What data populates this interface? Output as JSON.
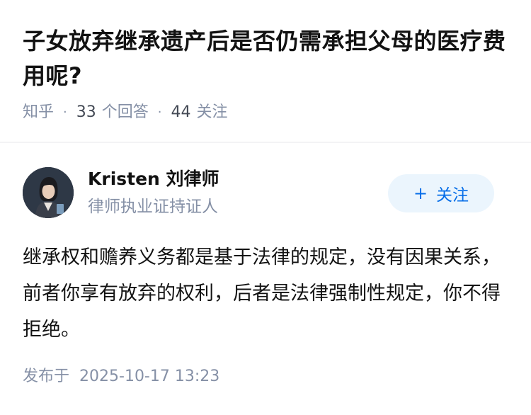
{
  "question": {
    "title": "子女放弃继承遗产后是否仍需承担父母的医疗费用呢?",
    "source": "知乎",
    "separator": "·",
    "answer_count": "33",
    "answer_label": "个回答",
    "follower_count": "44",
    "follower_label": "关注"
  },
  "author": {
    "name": "Kristen 刘律师",
    "bio": "律师执业证持证人",
    "avatar_icon": "person-portrait-icon"
  },
  "follow_button": {
    "plus": "+",
    "label": "关注"
  },
  "answer": {
    "content": "继承权和赡养义务都是基于法律的规定，没有因果关系，前者你享有放弃的权利，后者是法律强制性规定，你不得拒绝。",
    "published_label": "发布于",
    "published_time": "2025-10-17 13:23"
  },
  "colors": {
    "accent": "#056de8",
    "accent_bg": "#ebf5fd",
    "muted": "#8590a6",
    "text": "#121212"
  }
}
